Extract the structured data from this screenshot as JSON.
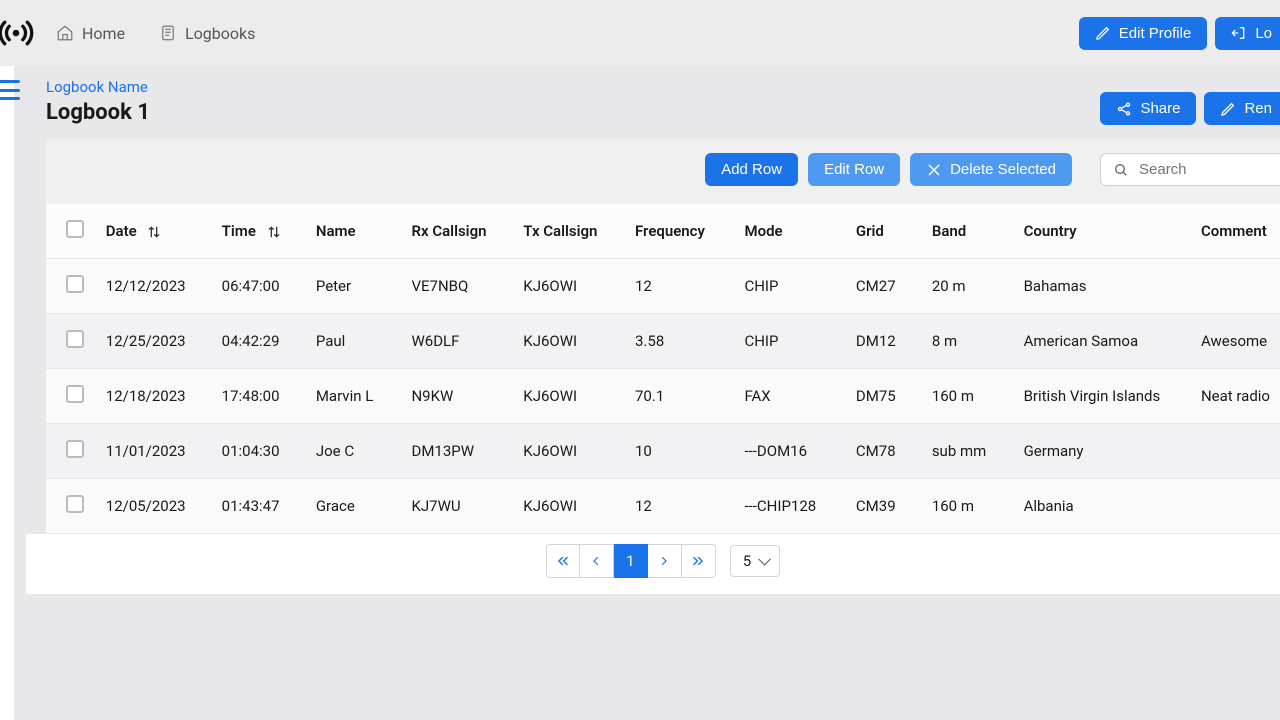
{
  "nav": {
    "home": "Home",
    "logbooks": "Logbooks",
    "edit_profile": "Edit Profile",
    "logout_partial": "Lo"
  },
  "header": {
    "breadcrumb": "Logbook Name",
    "title": "Logbook 1",
    "share": "Share",
    "rename_partial": "Ren"
  },
  "toolbar": {
    "add_row": "Add Row",
    "edit_row": "Edit Row",
    "delete_selected": "Delete Selected",
    "search_placeholder": "Search"
  },
  "columns": {
    "date": "Date",
    "time": "Time",
    "name": "Name",
    "rx": "Rx Callsign",
    "tx": "Tx Callsign",
    "freq": "Frequency",
    "mode": "Mode",
    "grid": "Grid",
    "band": "Band",
    "country": "Country",
    "comment": "Comment"
  },
  "rows": [
    {
      "date": "12/12/2023",
      "time": "06:47:00",
      "name": "Peter",
      "rx": "VE7NBQ",
      "tx": "KJ6OWI",
      "freq": "12",
      "mode": "CHIP",
      "grid": "CM27",
      "band": "20 m",
      "country": "Bahamas",
      "comment": ""
    },
    {
      "date": "12/25/2023",
      "time": "04:42:29",
      "name": "Paul",
      "rx": "W6DLF",
      "tx": "KJ6OWI",
      "freq": "3.58",
      "mode": "CHIP",
      "grid": "DM12",
      "band": "8 m",
      "country": "American Samoa",
      "comment": "Awesome"
    },
    {
      "date": "12/18/2023",
      "time": "17:48:00",
      "name": "Marvin L",
      "rx": "N9KW",
      "tx": "KJ6OWI",
      "freq": "70.1",
      "mode": "FAX",
      "grid": "DM75",
      "band": "160 m",
      "country": "British Virgin Islands",
      "comment": "Neat radio"
    },
    {
      "date": "11/01/2023",
      "time": "01:04:30",
      "name": "Joe C",
      "rx": "DM13PW",
      "tx": "KJ6OWI",
      "freq": "10",
      "mode": "---DOM16",
      "grid": "CM78",
      "band": "sub mm",
      "country": "Germany",
      "comment": ""
    },
    {
      "date": "12/05/2023",
      "time": "01:43:47",
      "name": "Grace",
      "rx": "KJ7WU",
      "tx": "KJ6OWI",
      "freq": "12",
      "mode": "---CHIP128",
      "grid": "CM39",
      "band": "160 m",
      "country": "Albania",
      "comment": ""
    }
  ],
  "pagination": {
    "current": "1",
    "page_size": "5"
  },
  "colors": {
    "primary": "#1a73e8",
    "primary_light": "#4e9af1"
  }
}
